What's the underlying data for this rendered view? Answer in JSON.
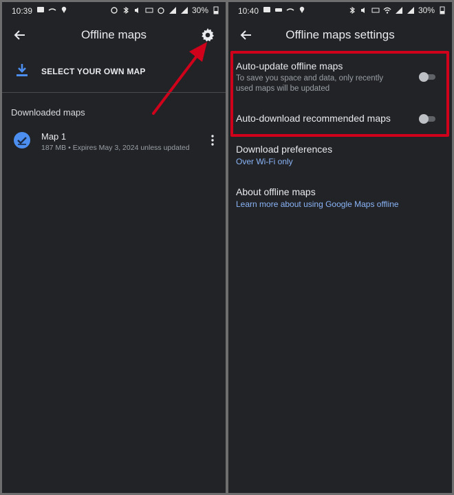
{
  "left": {
    "status": {
      "time": "10:39",
      "battery": "30%"
    },
    "title": "Offline maps",
    "select_label": "SELECT YOUR OWN MAP",
    "section_header": "Downloaded maps",
    "map": {
      "name": "Map 1",
      "meta": "187 MB • Expires May 3, 2024 unless updated"
    }
  },
  "right": {
    "status": {
      "time": "10:40",
      "battery": "30%"
    },
    "title": "Offline maps settings",
    "auto_update": {
      "title": "Auto-update offline maps",
      "subtitle": "To save you space and data, only recently used maps will be updated",
      "enabled": false
    },
    "auto_download": {
      "title": "Auto-download recommended maps",
      "enabled": false
    },
    "download_prefs": {
      "title": "Download preferences",
      "value": "Over Wi-Fi only"
    },
    "about": {
      "title": "About offline maps",
      "link": "Learn more about using Google Maps offline"
    }
  },
  "colors": {
    "background": "#222326",
    "accent_blue": "#8ab4f8",
    "icon_blue": "#4d8ff0",
    "annotation_red": "#d0021b"
  },
  "icons": [
    "back-arrow",
    "gear",
    "download",
    "check-circle",
    "more-vert"
  ]
}
